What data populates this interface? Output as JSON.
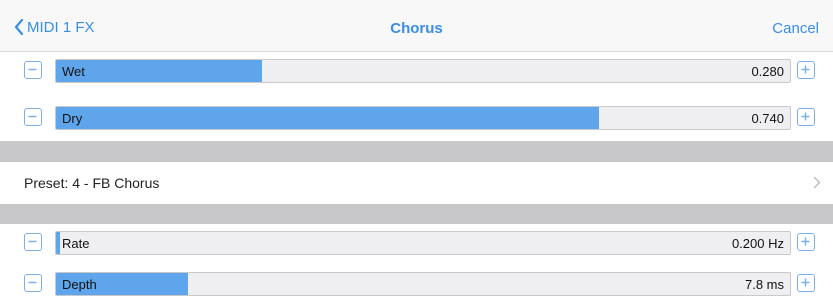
{
  "nav": {
    "back_label": "MIDI 1 FX",
    "title": "Chorus",
    "cancel_label": "Cancel"
  },
  "params_top": [
    {
      "label": "Wet",
      "value": "0.280",
      "fill": 0.28
    },
    {
      "label": "Dry",
      "value": "0.740",
      "fill": 0.74
    }
  ],
  "preset": {
    "label": "Preset: 4 - FB Chorus"
  },
  "params_bottom": [
    {
      "label": "Rate",
      "value": "0.200 Hz",
      "fill": 0.005
    },
    {
      "label": "Depth",
      "value": "7.8 ms",
      "fill": 0.18
    }
  ],
  "colors": {
    "accent": "#3a8ee6",
    "slider_fill": "#5ea5ec",
    "slider_track": "#efeff2",
    "separator": "#c8c8cb"
  },
  "icons": {
    "back": "chevron-left-icon",
    "minus": "minus-icon",
    "plus": "plus-icon",
    "disclosure": "chevron-right-icon"
  }
}
